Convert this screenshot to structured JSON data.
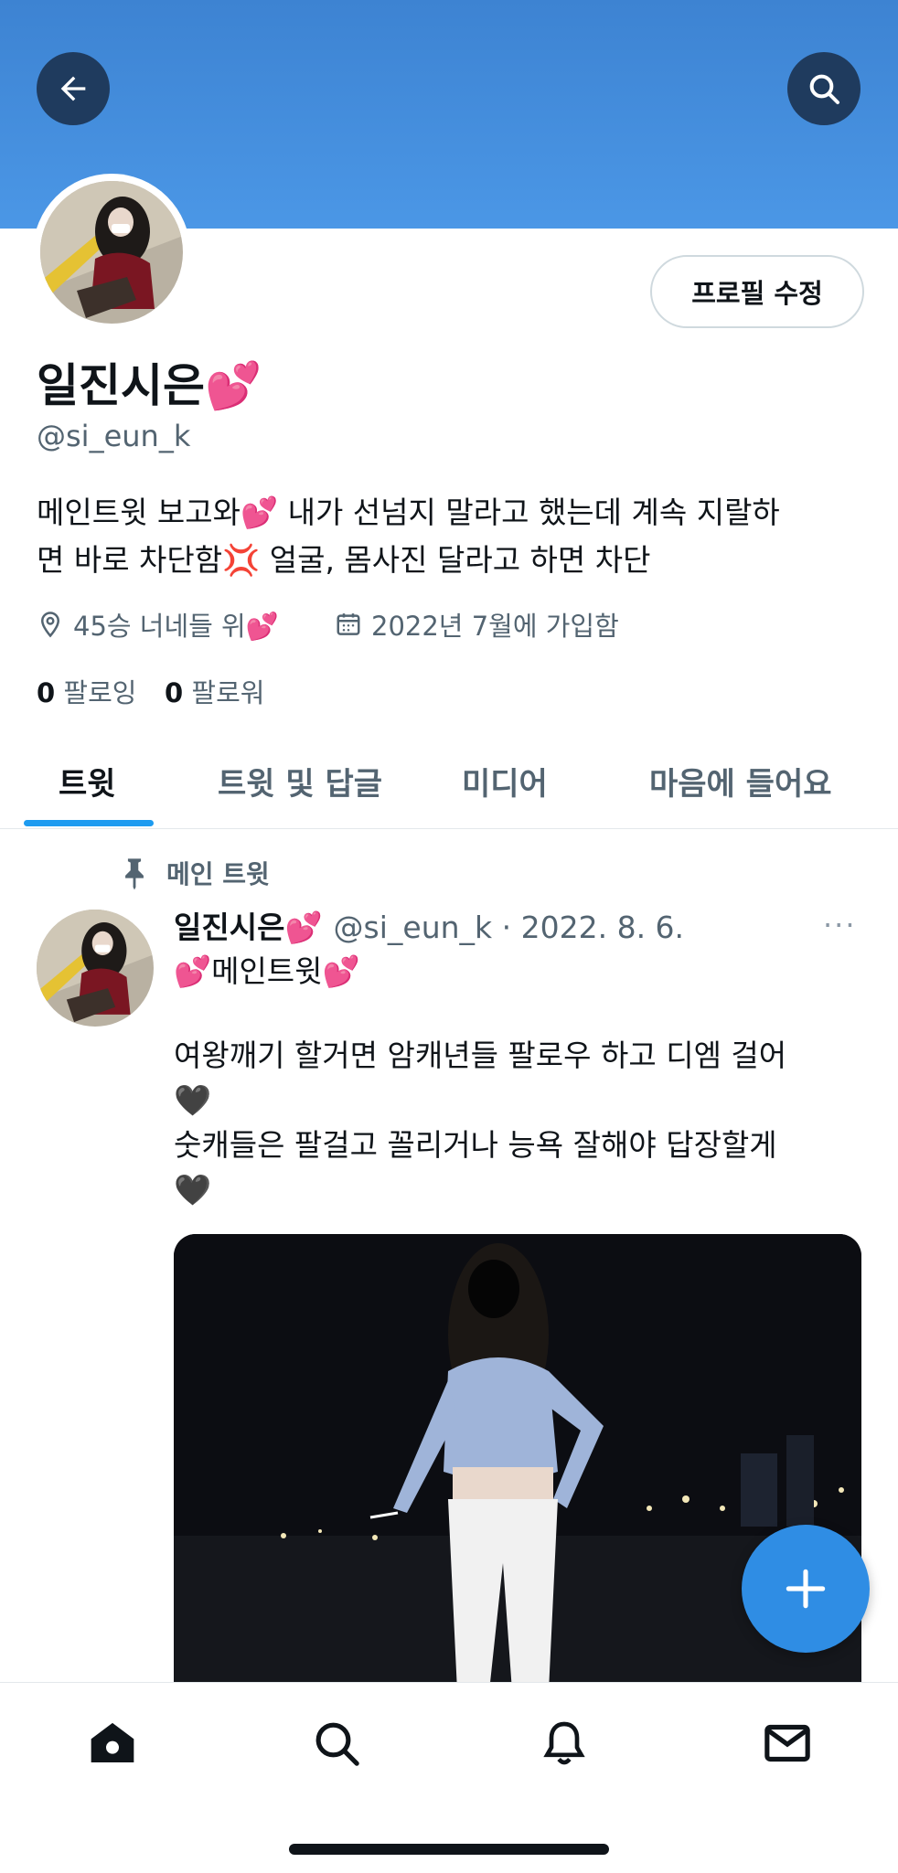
{
  "header": {
    "back_icon": "arrow-left-icon",
    "search_icon": "search-icon"
  },
  "profile": {
    "edit_button": "프로필 수정",
    "display_name": "일진시은💕",
    "handle": "@si_eun_k",
    "bio_line1": "메인트윗 보고와💕 내가 선넘지 말라고 했는데 계속 지랄하",
    "bio_line2": "면 바로 차단함💢 얼굴, 몸사진 달라고 하면 차단",
    "location": "45승 너네들 위💕",
    "joined": "2022년 7월에 가입함",
    "following_count": "0",
    "following_label": "팔로잉",
    "followers_count": "0",
    "followers_label": "팔로워"
  },
  "tabs": [
    {
      "label": "트윗",
      "active": true
    },
    {
      "label": "트윗 및 답글",
      "active": false
    },
    {
      "label": "미디어",
      "active": false
    },
    {
      "label": "마음에 들어요",
      "active": false
    }
  ],
  "tweet": {
    "pinned_label": "메인 트윗",
    "name": "일진시은💕",
    "handle_date": "@si_eun_k · 2022. 8. 6.",
    "more": "···",
    "title": "💕메인트윗💕",
    "body_line1": "여왕깨기 할거면 암캐년들 팔로우 하고 디엠 걸어",
    "body_line2": "🖤",
    "body_line3": "숫캐들은 팔걸고 꼴리거나 능욕 잘해야 답장할게",
    "body_line4": "🖤"
  },
  "fab": {
    "icon": "plus-icon"
  },
  "bottom_nav": [
    "home-icon",
    "search-icon",
    "bell-icon",
    "mail-icon"
  ],
  "colors": {
    "banner": "#4a90e2",
    "accent": "#1d9bf0",
    "fab": "#2f8de4",
    "secondary_text": "#536471"
  }
}
